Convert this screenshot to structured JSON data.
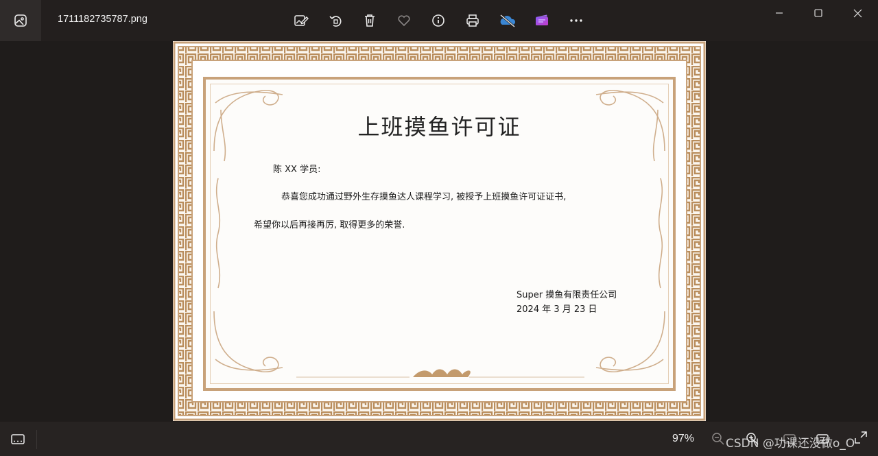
{
  "window": {
    "filename": "1711182735787.png",
    "toolbar": [
      {
        "icon": "edit-image-icon"
      },
      {
        "icon": "rotate-icon"
      },
      {
        "icon": "delete-icon"
      },
      {
        "icon": "favorite-heart-icon"
      },
      {
        "icon": "file-info-icon"
      },
      {
        "icon": "print-icon"
      },
      {
        "icon": "onedrive-sync-off-icon"
      },
      {
        "icon": "clipchamp-icon"
      },
      {
        "icon": "more-options-icon"
      }
    ],
    "controls": [
      "minimize",
      "maximize",
      "close"
    ]
  },
  "certificate": {
    "title": "上班摸鱼许可证",
    "salutation": "陈 XX 学员:",
    "body_line1": "恭喜您成功通过野外生存摸鱼达人课程学习, 被授予上班摸鱼许可证证书,",
    "body_line2": "希望你以后再接再厉, 取得更多的荣誉.",
    "issuer": "Super 摸鱼有限责任公司",
    "date": "2024 年 3 月 23 日",
    "colors": {
      "border": "#c8a27a",
      "text": "#1a1a1a"
    }
  },
  "bottom_bar": {
    "zoom": "97%",
    "watermark": "CSDN @功课还没做o_O"
  }
}
